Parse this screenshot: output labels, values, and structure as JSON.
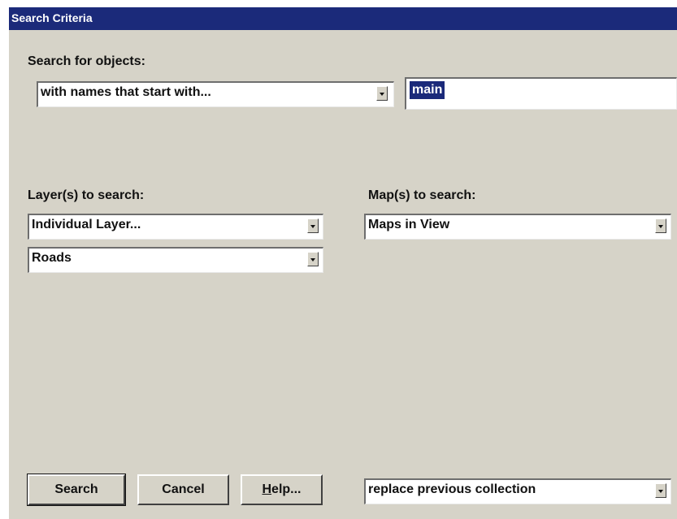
{
  "window": {
    "title": "Search Criteria"
  },
  "search_for": {
    "label": "Search for objects:",
    "mode_value": "with names that start with...",
    "query_value": "main"
  },
  "layers": {
    "label": "Layer(s) to search:",
    "scope_value": "Individual Layer...",
    "layer_value": "Roads"
  },
  "maps": {
    "label": "Map(s) to search:",
    "scope_value": "Maps in View"
  },
  "buttons": {
    "search": "Search",
    "cancel": "Cancel",
    "help_accel": "H",
    "help_rest": "elp..."
  },
  "collection": {
    "value": "replace previous collection"
  },
  "colors": {
    "titlebar": "#1b2a7a",
    "dialog_bg": "#d6d3c8",
    "selection": "#1b2a7a"
  }
}
